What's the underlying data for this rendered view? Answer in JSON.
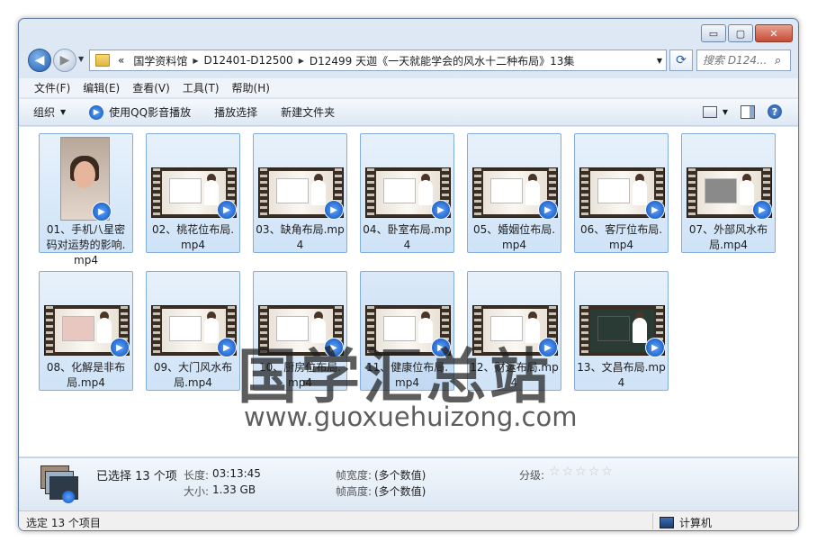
{
  "window": {
    "minimize": "▭",
    "maximize": "▢",
    "close": "✕"
  },
  "address": {
    "overflow": "«",
    "crumbs": [
      "国学资料馆",
      "D12401-D12500",
      "D12499 天迦《一天就能学会的风水十二种布局》13集"
    ]
  },
  "search": {
    "placeholder": "搜索 D124..."
  },
  "menu": [
    "文件(F)",
    "编辑(E)",
    "查看(V)",
    "工具(T)",
    "帮助(H)"
  ],
  "toolbar": {
    "organize": "组织",
    "play": "使用QQ影音播放",
    "playlist": "播放选择",
    "new_folder": "新建文件夹"
  },
  "files": [
    "01、手机八星密码对运势的影响.mp4",
    "02、桃花位布局.mp4",
    "03、缺角布局.mp4",
    "04、卧室布局.mp4",
    "05、婚姻位布局.mp4",
    "06、客厅位布局.mp4",
    "07、外部风水布局.mp4",
    "08、化解是非布局.mp4",
    "09、大门风水布局.mp4",
    "10、厨房位布局.mp4",
    "11、健康位布局.mp4",
    "12、财运布局.mp4",
    "13、文昌布局.mp4"
  ],
  "watermark": {
    "text": "国学汇总站",
    "url": "www.guoxuehuizong.com"
  },
  "details": {
    "selected": "已选择 13 个项",
    "duration_label": "长度:",
    "duration": "03:13:45",
    "size_label": "大小:",
    "size": "1.33 GB",
    "width_label": "帧宽度:",
    "width": "(多个数值)",
    "height_label": "帧高度:",
    "height": "(多个数值)",
    "rating_label": "分级:",
    "rating": 0
  },
  "status": {
    "left": "选定 13 个项目",
    "right": "计算机"
  },
  "colors": {
    "tile_bg": "#cfe3f7",
    "tile_border": "#84acdd",
    "qq_badge": "#0c4fb8"
  }
}
